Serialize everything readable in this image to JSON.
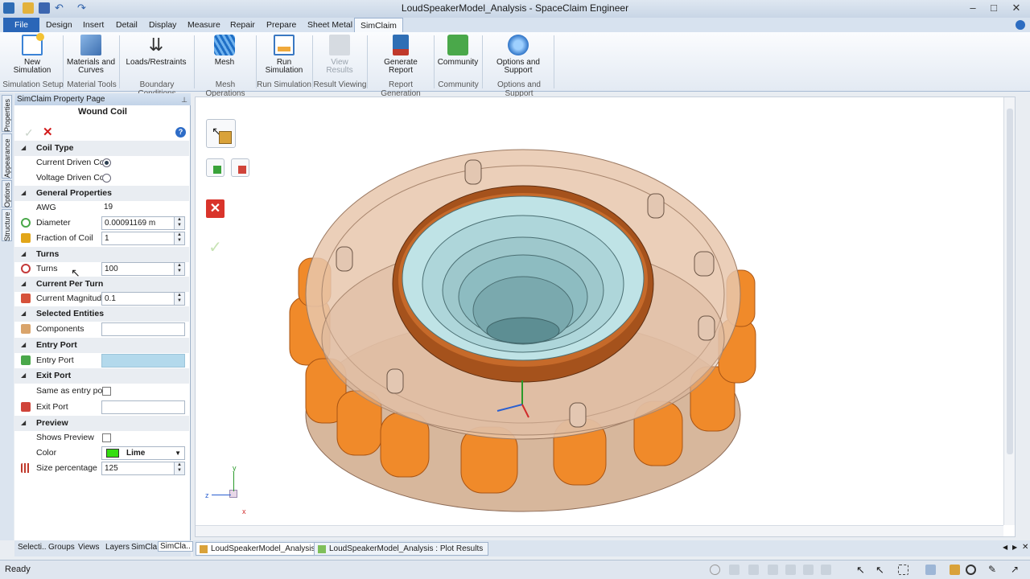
{
  "window": {
    "title": "LoudSpeakerModel_Analysis - SpaceClaim Engineer"
  },
  "ribbon_tabs": [
    "File",
    "Design",
    "Insert",
    "Detail",
    "Display",
    "Measure",
    "Repair",
    "Prepare",
    "Sheet Metal",
    "SimClaim"
  ],
  "active_tab": "SimClaim",
  "ribbon": {
    "buttons": [
      {
        "line1": "New",
        "line2": "Simulation",
        "icon": "new-simulation-icon",
        "color": "#3b83d6"
      },
      {
        "line1": "Materials and",
        "line2": "Curves",
        "icon": "materials-icon",
        "color": "#5b8fc9"
      },
      {
        "line1": "Loads/Restraints",
        "line2": "",
        "icon": "loads-icon",
        "color": "#333333"
      },
      {
        "line1": "Mesh",
        "line2": "",
        "icon": "mesh-icon",
        "color": "#2a7bd0"
      },
      {
        "line1": "Run",
        "line2": "Simulation",
        "icon": "run-simulation-icon",
        "color": "#3a78c2"
      },
      {
        "line1": "View",
        "line2": "Results",
        "icon": "view-results-icon",
        "color": "#b9c0c8"
      },
      {
        "line1": "Generate",
        "line2": "Report",
        "icon": "report-icon",
        "color": "#2f6fb5"
      },
      {
        "line1": "Community",
        "line2": "",
        "icon": "community-icon",
        "color": "#4aa84a"
      },
      {
        "line1": "Options and",
        "line2": "Support",
        "icon": "options-icon",
        "color": "#3a7fd0"
      }
    ],
    "groups": [
      "Simulation Setup",
      "Material Tools",
      "Boundary Conditions",
      "Mesh Operations",
      "Run Simulation",
      "Result Viewing",
      "Report Generation",
      "Community",
      "Options and Support"
    ]
  },
  "side_tabs": [
    "Properties",
    "Appearance",
    "Options",
    "Structure"
  ],
  "panel": {
    "title": "SimClaim Property Page",
    "subtitle": "Wound Coil",
    "categories": {
      "coil_type": "Coil Type",
      "general": "General Properties",
      "turns": "Turns",
      "current_per_turn": "Current Per Turn",
      "selected": "Selected Entities",
      "entry": "Entry Port",
      "exit": "Exit Port",
      "preview": "Preview"
    },
    "fields": {
      "current_driven": {
        "label": "Current Driven Coil",
        "selected": true
      },
      "voltage_driven": {
        "label": "Voltage Driven Coil",
        "selected": false
      },
      "awg": {
        "label": "AWG",
        "value": "19"
      },
      "diameter": {
        "label": "Diameter",
        "value": "0.00091169 m"
      },
      "fraction": {
        "label": "Fraction of Coil",
        "value": "1"
      },
      "turns": {
        "label": "Turns",
        "value": "100"
      },
      "current_magnitude": {
        "label": "Current Magnitude",
        "value": "0.1"
      },
      "components": {
        "label": "Components",
        "value": ""
      },
      "entry_port": {
        "label": "Entry Port",
        "value": ""
      },
      "same_as_entry": {
        "label": "Same as entry port",
        "checked": false
      },
      "exit_port": {
        "label": "Exit Port",
        "value": ""
      },
      "shows_preview": {
        "label": "Shows Preview",
        "checked": false
      },
      "color": {
        "label": "Color",
        "value": "Lime",
        "swatch": "#33dd11"
      },
      "size_percentage": {
        "label": "Size percentage",
        "value": "125"
      }
    },
    "bottom_tabs": [
      "Selecti..",
      "Groups",
      "Views",
      "Layers",
      "SimCla..",
      "SimCla.."
    ]
  },
  "doc_tabs": [
    "LoudSpeakerModel_Analysis",
    "LoudSpeakerModel_Analysis : Plot Results"
  ],
  "status": {
    "text": "Ready"
  },
  "triad": {
    "x": "x",
    "y": "y",
    "z": "z"
  },
  "colors": {
    "coil_orange": "#f08a2a",
    "body_tan": "#d9b79a",
    "cone_cyan": "#bfe3e6",
    "ring_brown": "#a5521c"
  }
}
